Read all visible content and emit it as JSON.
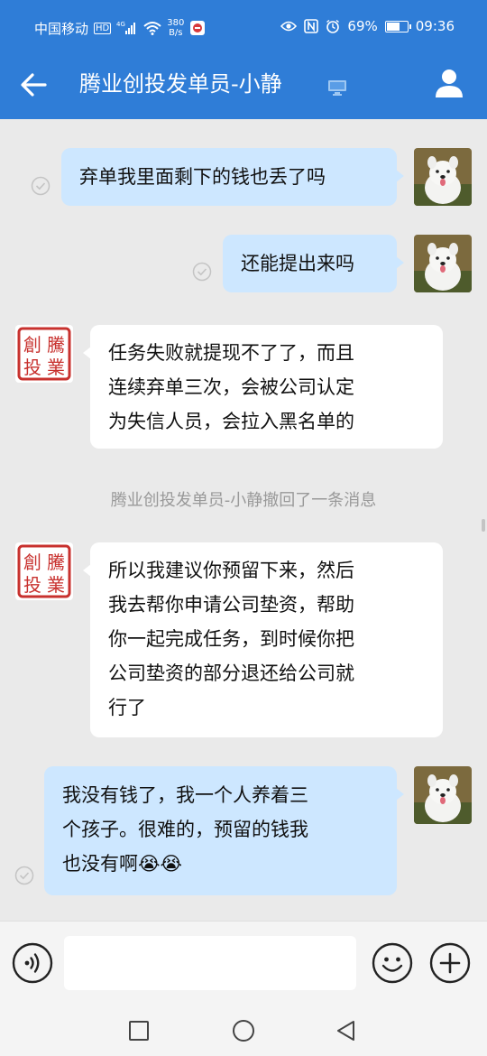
{
  "status_bar": {
    "carrier": "中国移动",
    "hd": "HD",
    "net_type": "4G",
    "speed_value": "380",
    "speed_unit": "B/s",
    "battery": "69%",
    "battery_level": 0.69,
    "time": "09:36"
  },
  "header": {
    "title": "腾业创投发单员-小静",
    "back_icon": "back-arrow-icon",
    "profile_icon": "person-icon",
    "device_icon": "monitor-icon"
  },
  "stamp": {
    "chars": [
      "創",
      "騰",
      "投",
      "業"
    ],
    "color": "#c8312e"
  },
  "messages": [
    {
      "direction": "out",
      "lines": [
        "弃单我里面剩下的钱也丢了吗"
      ]
    },
    {
      "direction": "out",
      "lines": [
        "还能提出来吗"
      ]
    },
    {
      "direction": "in",
      "lines": [
        "任务失败就提现不了了，而且",
        "连续弃单三次，会被公司认定",
        "为失信人员，会拉入黑名单的"
      ]
    },
    {
      "direction": "in",
      "lines": [
        "所以我建议你预留下来，然后",
        "我去帮你申请公司垫资，帮助",
        "你一起完成任务，到时候你把",
        "公司垫资的部分退还给公司就",
        "行了"
      ]
    },
    {
      "direction": "out",
      "lines": [
        "我没有钱了，我一个人养着三",
        "个孩子。很难的，预留的钱我",
        "也没有啊😭😭"
      ]
    }
  ],
  "system_notice": "腾业创投发单员-小静撤回了一条消息",
  "input": {
    "value": "",
    "voice_icon": "voice-icon",
    "emoji_icon": "emoji-icon",
    "plus_icon": "plus-icon"
  },
  "nav": {
    "icons": [
      "recents-square-icon",
      "home-circle-icon",
      "back-triangle-icon"
    ]
  },
  "colors": {
    "header_bg": "#2f7dd7",
    "outgoing_bubble": "#cde7ff",
    "incoming_bubble": "#ffffff",
    "chat_bg": "#eaeaea"
  }
}
